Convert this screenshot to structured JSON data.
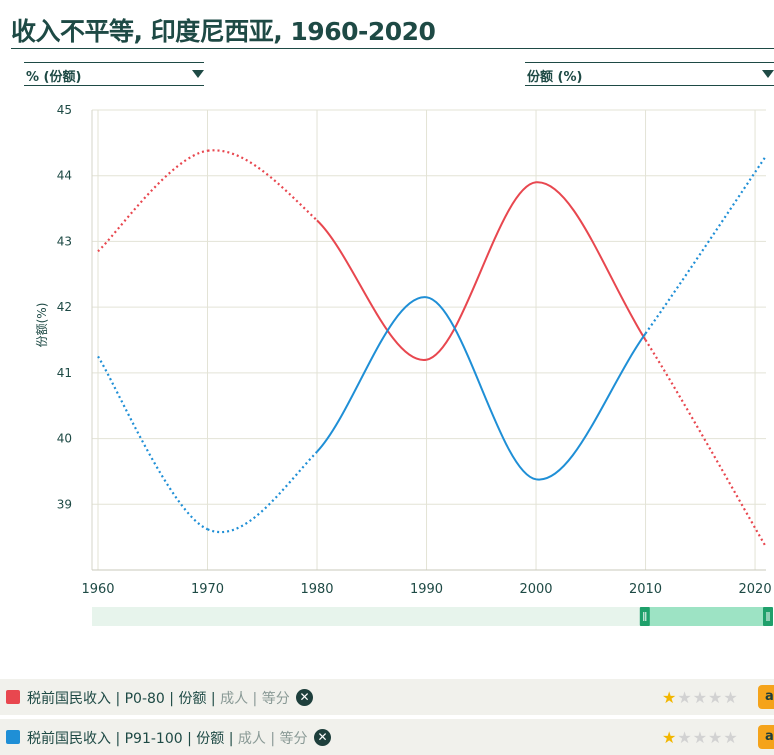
{
  "title": "收入不平等, 印度尼西亚, 1960-2020",
  "dropdown_left": {
    "label": "% (份额)"
  },
  "dropdown_right": {
    "label": "份额 (%)"
  },
  "legend": [
    {
      "id": "row1",
      "color": "#e8474f",
      "text_main": "税前国民收入 | P0-80 | 份额 | ",
      "text_muted": "成人 | 等分",
      "stars": 1,
      "stars_total": 5,
      "badge": "a"
    },
    {
      "id": "row2",
      "color": "#1f8fd6",
      "text_main": "税前国民收入 | P91-100 | 份额 | ",
      "text_muted": "成人 | 等分",
      "stars": 1,
      "stars_total": 5,
      "badge": "a"
    }
  ],
  "icons": {
    "remove": "close-circle-icon",
    "dropdown": "triangle-down-icon",
    "rating": "star-icon"
  },
  "slider": {
    "range_start": 0.81,
    "range_end": 1.0
  },
  "chart_data": {
    "type": "line",
    "ylabel": "份额(%)",
    "xlabel": "",
    "xlim": [
      1960,
      2021
    ],
    "ylim": [
      38,
      45
    ],
    "x_ticks": [
      1960,
      1970,
      1980,
      1990,
      2000,
      2010,
      2020
    ],
    "y_ticks": [
      39,
      40,
      41,
      42,
      43,
      44,
      45
    ],
    "grid": true,
    "solid_range": [
      1980,
      2010
    ],
    "series": [
      {
        "color": "#e8474f",
        "x": [
          1960,
          1970,
          1980,
          1990,
          2000,
          2010,
          2021
        ],
        "y": [
          42.85,
          44.38,
          43.32,
          41.2,
          43.9,
          41.5,
          38.35
        ]
      },
      {
        "color": "#1f8fd6",
        "x": [
          1960,
          1970,
          1980,
          1990,
          2000,
          2010,
          2021
        ],
        "y": [
          41.25,
          38.62,
          39.8,
          42.15,
          39.38,
          41.6,
          44.3
        ]
      }
    ]
  }
}
